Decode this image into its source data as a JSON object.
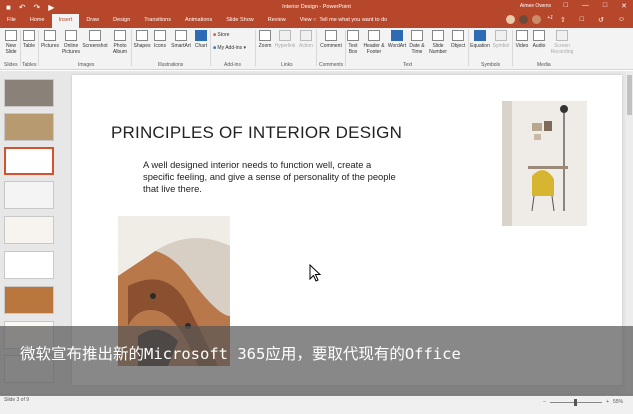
{
  "window": {
    "title": "Interior Design - PowerPoint",
    "user": "Aimee Owens",
    "collab_count": "+1"
  },
  "tabs": [
    "File",
    "Home",
    "Insert",
    "Draw",
    "Design",
    "Transitions",
    "Animations",
    "Slide Show",
    "Review",
    "View"
  ],
  "active_tab": "Insert",
  "tell_me": "Tell me what you want to do",
  "ribbon": {
    "buttons": {
      "new_slide": "New Slide",
      "table": "Table",
      "pictures": "Pictures",
      "online_pictures": "Online Pictures",
      "screenshot": "Screenshot",
      "photo_album": "Photo Album",
      "shapes": "Shapes",
      "icons": "Icons",
      "smartart": "SmartArt",
      "chart": "Chart",
      "store": "Store",
      "my_addins": "My Add-ins",
      "zoom": "Zoom",
      "hyperlink": "Hyperlink",
      "action": "Action",
      "comment": "Comment",
      "text_box": "Text Box",
      "header_footer": "Header & Footer",
      "wordart": "WordArt",
      "date_time": "Date & Time",
      "slide_number": "Slide Number",
      "object": "Object",
      "equation": "Equation",
      "symbol": "Symbol",
      "video": "Video",
      "audio": "Audio",
      "screen_recording": "Screen Recording"
    },
    "groups": {
      "slides": "Slides",
      "tables": "Tables",
      "images": "Images",
      "illustrations": "Illustrations",
      "addins": "Add-ins",
      "links": "Links",
      "comments": "Comments",
      "text": "Text",
      "symbols": "Symbols",
      "media": "Media"
    }
  },
  "slide": {
    "title": "PRINCIPLES OF INTERIOR DESIGN",
    "body": "A well designed interior needs to function well, create a specific feeling, and give a sense of personality of the people that live there."
  },
  "thumbnail_count": 9,
  "selected_thumbnail": 3,
  "status": {
    "slide_info": "Slide 3 of 9",
    "zoom": "55%"
  },
  "caption": "微软宣布推出新的Microsoft 365应用，要取代现有的Office",
  "colors": {
    "brand": "#b7472a",
    "accent_select": "#d35230"
  }
}
